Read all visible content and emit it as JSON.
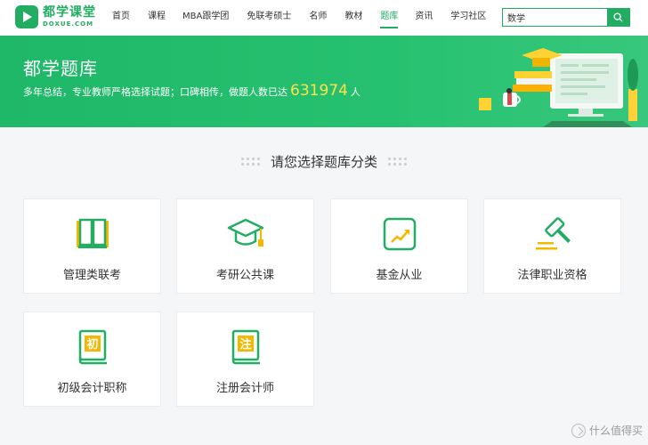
{
  "logo": {
    "cn": "都学课堂",
    "en": "DOXUE.COM"
  },
  "nav": [
    {
      "label": "首页",
      "active": false
    },
    {
      "label": "课程",
      "active": false
    },
    {
      "label": "MBA跟学团",
      "active": false
    },
    {
      "label": "免联考硕士",
      "active": false
    },
    {
      "label": "名师",
      "active": false
    },
    {
      "label": "教材",
      "active": false
    },
    {
      "label": "题库",
      "active": true
    },
    {
      "label": "资讯",
      "active": false
    },
    {
      "label": "学习社区",
      "active": false
    }
  ],
  "search": {
    "value": "数学",
    "icon": "search-icon"
  },
  "banner": {
    "title": "都学题库",
    "subtitle_prefix": "多年总结，专业教师严格选择试题；口碑相传，做题人数已达",
    "count": "631974",
    "subtitle_suffix": "人"
  },
  "section": {
    "title": "请您选择题库分类"
  },
  "categories": [
    {
      "label": "管理类联考",
      "icon": "open-book-icon"
    },
    {
      "label": "考研公共课",
      "icon": "graduation-cap-icon"
    },
    {
      "label": "基金从业",
      "icon": "trend-chart-icon"
    },
    {
      "label": "法律职业资格",
      "icon": "gavel-icon"
    },
    {
      "label": "初级会计职称",
      "icon": "book-chu-icon",
      "glyph": "初"
    },
    {
      "label": "注册会计师",
      "icon": "book-zhu-icon",
      "glyph": "注"
    }
  ],
  "watermark": {
    "text": "什么值得买"
  },
  "colors": {
    "brand": "#22ad63",
    "accent": "#ffe14a",
    "icon_yellow": "#f5b800"
  }
}
